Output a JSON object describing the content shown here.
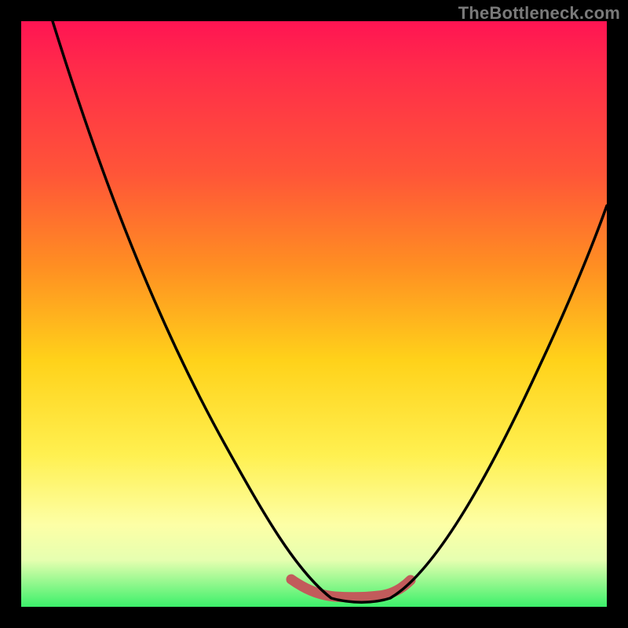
{
  "watermark": "TheBottleneck.com",
  "chart_data": {
    "type": "line",
    "title": "",
    "xlabel": "",
    "ylabel": "",
    "xlim": [
      0,
      100
    ],
    "ylim": [
      0,
      100
    ],
    "grid": false,
    "legend": "none",
    "background_gradient": {
      "direction": "vertical_top_to_bottom",
      "stops": [
        {
          "pos": 0,
          "color": "#ff1453"
        },
        {
          "pos": 26,
          "color": "#ff5538"
        },
        {
          "pos": 58,
          "color": "#ffd21a"
        },
        {
          "pos": 86,
          "color": "#fdffa6"
        },
        {
          "pos": 100,
          "color": "#3cf06a"
        }
      ]
    },
    "series": [
      {
        "name": "bottleneck-curve",
        "color": "#000000",
        "x": [
          0,
          6,
          12,
          18,
          24,
          30,
          36,
          42,
          46,
          50,
          52,
          56,
          60,
          64,
          68,
          72,
          76,
          82,
          88,
          94,
          100
        ],
        "y": [
          100,
          89,
          78,
          66,
          54,
          42,
          30,
          18,
          10,
          4,
          2,
          1,
          1,
          2,
          6,
          12,
          20,
          29,
          38,
          47,
          56
        ]
      },
      {
        "name": "optimal-band",
        "color": "#c25b5b",
        "x": [
          46,
          50,
          54,
          58,
          62,
          66
        ],
        "y": [
          4,
          1.6,
          1.2,
          1.2,
          1.7,
          4
        ]
      }
    ],
    "notes": "V-shaped curve; y is a bottleneck/error metric (higher = worse, shown against the red end of the gradient). The pink band marks the low/optimal region near the minimum around x≈56–60."
  }
}
